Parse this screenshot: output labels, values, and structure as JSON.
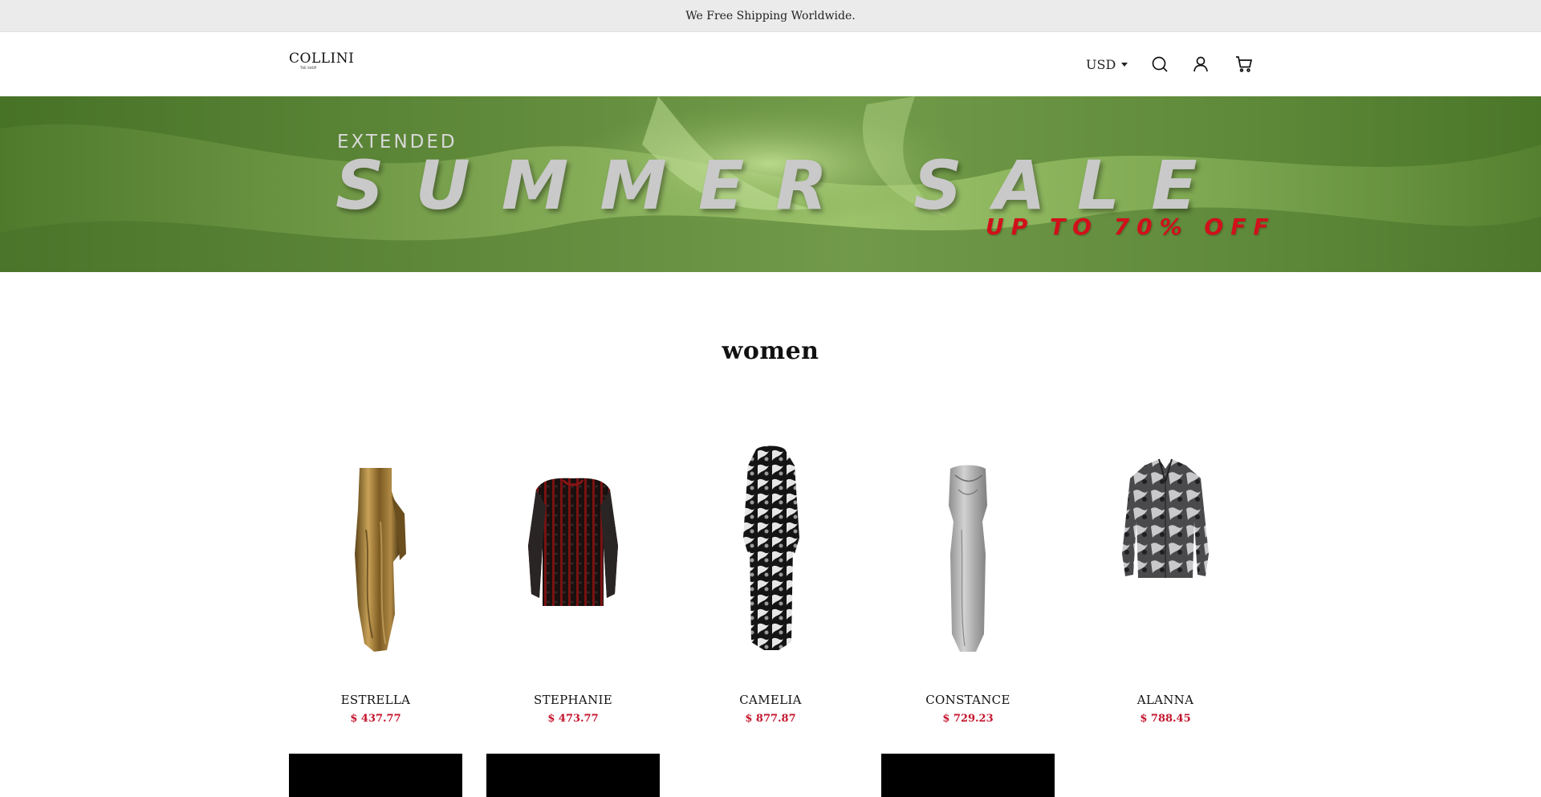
{
  "announcement": "We Free Shipping Worldwide.",
  "logo": {
    "word": "COLLINI",
    "tagline": "THE SHOP"
  },
  "header": {
    "currency": "USD",
    "icons": [
      "search-icon",
      "account-icon",
      "cart-icon"
    ]
  },
  "banner": {
    "extended": "EXTENDED",
    "headline": "SUMMER SALE",
    "offer": "UP TO 70% OFF",
    "colors": {
      "headline": "#c9c9c9",
      "offer": "#d1101a",
      "background": "#6f9445"
    }
  },
  "section": {
    "title": "women"
  },
  "products": [
    {
      "name": "ESTRELLA",
      "price": "$ 437.77"
    },
    {
      "name": "STEPHANIE",
      "price": "$ 473.77"
    },
    {
      "name": "CAMELIA",
      "price": "$ 877.87"
    },
    {
      "name": "CONSTANCE",
      "price": "$ 729.23"
    },
    {
      "name": "ALANNA",
      "price": "$ 788.45"
    }
  ],
  "colors": {
    "price": "#c4152d",
    "announcement_bg": "#ebebeb"
  }
}
